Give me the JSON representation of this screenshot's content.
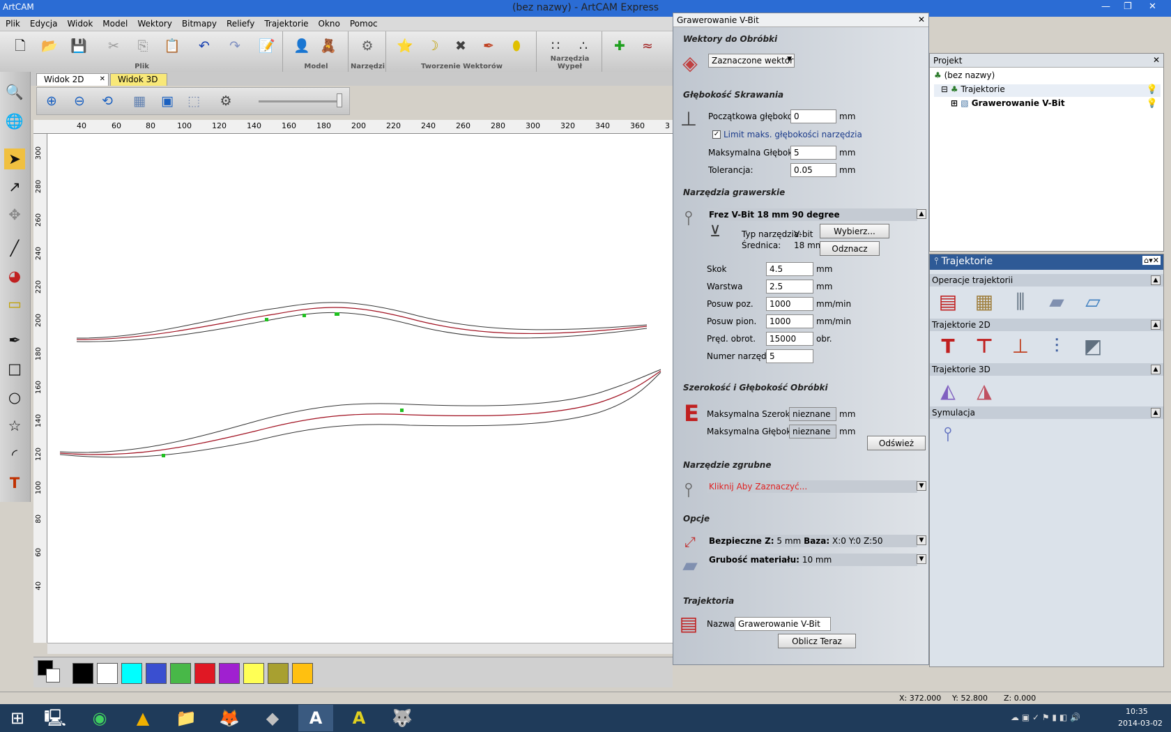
{
  "window": {
    "title": "(bez nazwy) - ArtCAM Express",
    "logo": "ArtCAM",
    "controls": [
      "—",
      "❐",
      "✕"
    ]
  },
  "menu": [
    "Plik",
    "Edycja",
    "Widok",
    "Model",
    "Wektory",
    "Bitmapy",
    "Reliefy",
    "Trajektorie",
    "Okno",
    "Pomoc"
  ],
  "toolbar": {
    "groups": [
      {
        "label": "Plik",
        "icons": [
          "🗋",
          "📂",
          "💾",
          "✂",
          "⎘",
          "📋",
          "↶",
          "↷",
          "📝"
        ]
      },
      {
        "label": "Model",
        "icons": [
          "👤",
          "🧸"
        ]
      },
      {
        "label": "Narzędzi",
        "icons": [
          "⚙"
        ]
      },
      {
        "label": "Tworzenie Wektorów",
        "icons": [
          "⭐",
          "☽",
          "✖",
          "✒",
          "⬮"
        ]
      },
      {
        "label": "Narzędzia Wypeł",
        "icons": [
          "∷",
          "∴"
        ]
      },
      {
        "label": "",
        "icons": [
          "✚",
          "≈"
        ]
      }
    ]
  },
  "left_tools": [
    "🔍",
    "🌐",
    "➤",
    "↗",
    "✥",
    "╱",
    "◕",
    "▭",
    "✒",
    "□",
    "○",
    "☆",
    "◜",
    "T"
  ],
  "tabs": [
    {
      "label": "Widok 2D",
      "close": "✕"
    },
    {
      "label": "Widok 3D"
    }
  ],
  "view_tools": [
    "⊕",
    "⊖",
    "⟲",
    "▦",
    "▣",
    "⬚",
    "⚙"
  ],
  "ruler": {
    "h": [
      "40",
      "60",
      "80",
      "100",
      "120",
      "140",
      "160",
      "180",
      "200",
      "220",
      "240",
      "260",
      "280",
      "300",
      "320",
      "340",
      "360",
      "3"
    ],
    "v": [
      "300",
      "280",
      "260",
      "240",
      "220",
      "200",
      "180",
      "160",
      "140",
      "120",
      "100",
      "80",
      "60",
      "40"
    ]
  },
  "swatches": [
    "#000000",
    "#ffffff",
    "#00ffff",
    "#3a4fd0",
    "#48b848",
    "#e01824",
    "#a020d0",
    "#ffff55",
    "#a8a030",
    "#ffc010"
  ],
  "vbit": {
    "title": "Grawerowanie V-Bit",
    "close": "✕",
    "s1": "Wektory do Obróbki",
    "vector_select": "Zaznaczone wektory",
    "s2": "Głębokość Skrawania",
    "start_depth_label": "Początkowa głębokość:",
    "start_depth": "0",
    "limit_label": "Limit maks. głębokości narzędzia",
    "max_depth_label": "Maksymalna Głębokość:",
    "max_depth": "5",
    "tol_label": "Tolerancja:",
    "tol": "0.05",
    "unit_mm": "mm",
    "s3": "Narzędzia grawerskie",
    "tool_name": "Frez V-Bit 18 mm 90 degree",
    "tool_type_label": "Typ narzędzia:",
    "tool_type": "V-bit",
    "diam_label": "Średnica:",
    "diam": "18 mm",
    "btn_select": "Wybierz...",
    "btn_deselect": "Odznacz",
    "step_label": "Skok",
    "step": "4.5",
    "layer_label": "Warstwa",
    "layer": "2.5",
    "feed_label": "Posuw poz.",
    "feed": "1000",
    "unit_feed": "mm/min",
    "plunge_label": "Posuw pion.",
    "plunge": "1000",
    "speed_label": "Pręd. obrot.",
    "speed": "15000",
    "unit_rpm": "obr.",
    "toolnum_label": "Numer narzędzia",
    "toolnum": "5",
    "s4": "Szerokość i Głębokość Obróbki",
    "mw_label": "Maksymalna Szerokość:",
    "mw": "nieznane",
    "md_label": "Maksymalna Głębokość:",
    "md": "nieznane",
    "btn_refresh": "Odśwież",
    "s5": "Narzędzie zgrubne",
    "rough": "Kliknij Aby Zaznaczyć...",
    "s6": "Opcje",
    "safez_label": "Bezpieczne Z:",
    "safez": "5 mm",
    "base_label": "Baza:",
    "base": "X:0 Y:0 Z:50",
    "thick_label": "Grubość materiału:",
    "thick": "10 mm",
    "s7": "Trajektoria",
    "name_label": "Nazwa:",
    "name": "Grawerowanie V-Bit",
    "btn_calc": "Oblicz Teraz"
  },
  "project": {
    "title": "Projekt",
    "close": "✕",
    "root": "(bez nazwy)",
    "child": "Trajektorie",
    "leaf": "Grawerowanie V-Bit"
  },
  "traj": {
    "title": "Trajektorie",
    "ops": "Operacje trajektorii",
    "t2d": "Trajektorie 2D",
    "t3d": "Trajektorie 3D",
    "sim": "Symulacja"
  },
  "status": {
    "x": "X: 372.000",
    "y": "Y: 52.800",
    "z": "Z: 0.000"
  },
  "taskbar": {
    "apps": [
      "⊞",
      "🖳",
      "◉",
      "▲",
      "📁",
      "🦊",
      "◆",
      "A",
      "A",
      "🐺"
    ],
    "time": "10:35",
    "date": "2014-03-02"
  }
}
